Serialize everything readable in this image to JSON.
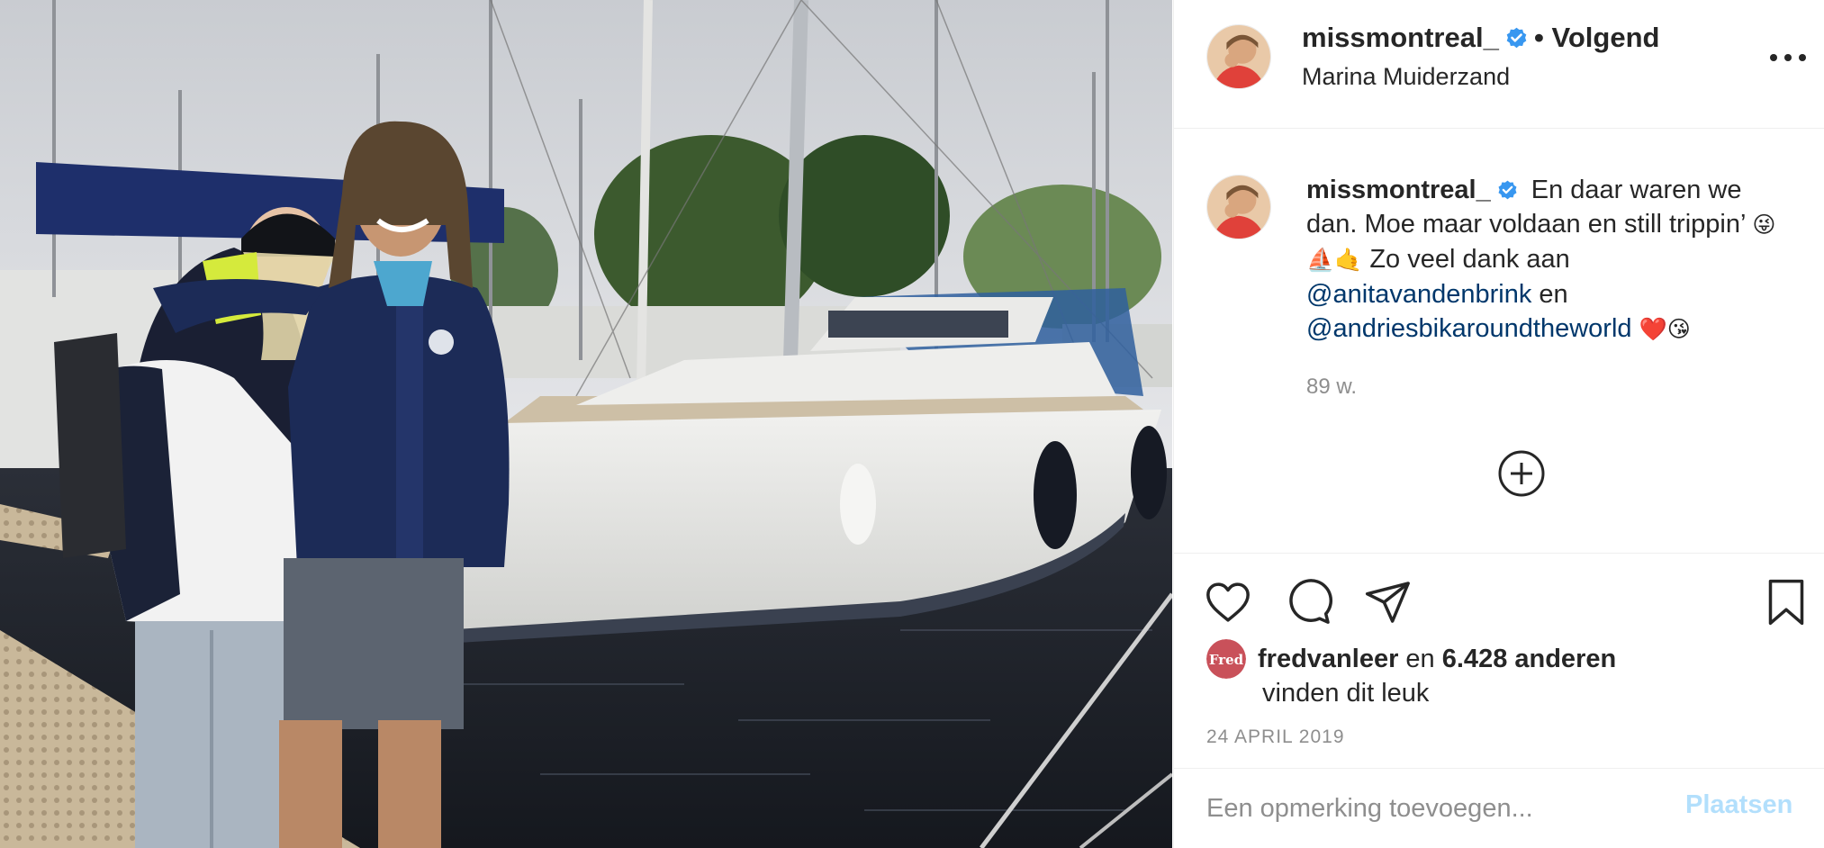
{
  "header": {
    "username": "missmontreal_",
    "follow_status": "• Volgend",
    "location": "Marina Muiderzand"
  },
  "caption": {
    "username": "missmontreal_",
    "text": "En daar waren we dan. Moe maar voldaan en still trippin’",
    "emojis_1": "😜⛵🤙",
    "text_2": "Zo veel dank aan",
    "mention_1": "@anitavandenbrink",
    "conjunction": "en",
    "mention_2": "@andriesbikaroundtheworld",
    "emojis_2": "❤️😘",
    "time_ago": "89 w."
  },
  "likes": {
    "liker": "fredvanleer",
    "joiner": "en",
    "others": "6.428 anderen",
    "suffix": "vinden dit leuk",
    "avatar_text": "Fred"
  },
  "post_date": "24 APRIL 2019",
  "comment_box": {
    "placeholder": "Een opmerking toevoegen...",
    "submit_label": "Plaatsen"
  },
  "icons": [
    "verified-badge-icon",
    "more-options-icon",
    "load-more-comments-icon",
    "heart-icon",
    "comment-icon",
    "share-icon",
    "bookmark-icon"
  ],
  "colors": {
    "link": "#00376b",
    "verified": "#3897f0",
    "secondary_text": "#8e8e8e",
    "post_button_disabled": "#b2dffc"
  }
}
